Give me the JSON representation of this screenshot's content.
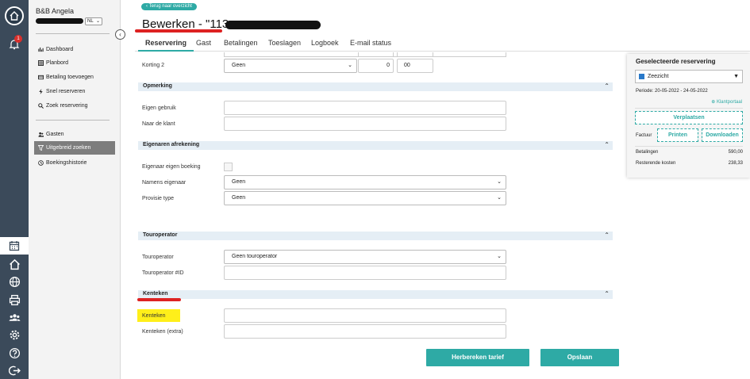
{
  "rail": {
    "notification_count": "1"
  },
  "sidebar": {
    "user_name": "B&B Angela",
    "language": "NL",
    "items": [
      {
        "label": "Dashboard",
        "icon": "dashboard-icon"
      },
      {
        "label": "Planbord",
        "icon": "calendar-grid-icon"
      },
      {
        "label": "Betaling toevoegen",
        "icon": "payment-icon"
      },
      {
        "label": "Snel reserveren",
        "icon": "lightning-icon"
      },
      {
        "label": "Zoek reservering",
        "icon": "search-icon"
      }
    ],
    "items2": [
      {
        "label": "Gasten",
        "icon": "guests-icon"
      },
      {
        "label": "Uitgebreid zoeken",
        "icon": "advanced-search-icon",
        "active": true
      },
      {
        "label": "Boekingshistorie",
        "icon": "history-icon"
      }
    ]
  },
  "header": {
    "back_label": "Terug naar overzicht",
    "title": "Bewerken - \"113"
  },
  "tabs": [
    {
      "label": "Reservering",
      "active": true
    },
    {
      "label": "Gast"
    },
    {
      "label": "Betalingen"
    },
    {
      "label": "Toeslagen"
    },
    {
      "label": "Logboek"
    },
    {
      "label": "E-mail status"
    }
  ],
  "korting": {
    "label": "Korting 2",
    "select": "Geen",
    "amount": "0",
    "cents": "00"
  },
  "sections": {
    "opmerking": {
      "title": "Opmerking",
      "eigen_gebruik": "Eigen gebruik",
      "naar_de_klant": "Naar de klant"
    },
    "eigenaren": {
      "title": "Eigenaren afrekening",
      "eigen_boeking": "Eigenaar eigen boeking",
      "namens_eigenaar": "Namens eigenaar",
      "namens_value": "Geen",
      "provisie_type": "Provisie type",
      "provisie_value": "Geen"
    },
    "touroperator": {
      "title": "Touroperator",
      "touroperator": "Touroperator",
      "touroperator_value": "Geen touroperator",
      "touroperator_id": "Touroperator #ID"
    },
    "kenteken": {
      "title": "Kenteken",
      "kenteken": "Kenteken",
      "kenteken_extra": "Kenteken (extra)"
    }
  },
  "buttons": {
    "herbereken": "Herbereken tarief",
    "opslaan": "Opslaan"
  },
  "panel": {
    "title": "Geselecteerde reservering",
    "room": "Zeezicht",
    "periode_label": "Periode:",
    "periode_value": "20-05-2022 - 24-05-2022",
    "klantportaal": "Klantportaal",
    "verplaatsen": "Verplaatsen",
    "factuur": "Factuur",
    "printen": "Printen",
    "downloaden": "Downloaden",
    "betalingen_label": "Betalingen",
    "betalingen_value": "590,00",
    "resterende_label": "Resterende kosten",
    "resterende_value": "238,33"
  },
  "colors": {
    "accent": "#2eaaa5",
    "rail": "#3b4a5a",
    "annotation_red": "#dd2222",
    "highlight": "#ffef1a"
  }
}
